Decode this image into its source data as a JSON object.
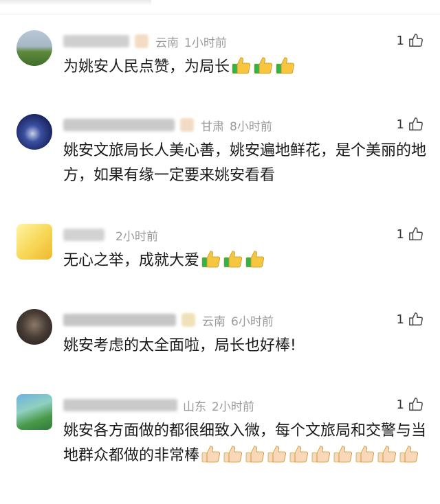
{
  "comments": [
    {
      "location": "云南",
      "time": "1小时前",
      "likes": "1",
      "text": "为姚安人民点赞，为局长",
      "emoji": {
        "name": "thumbs-up-emoji",
        "count": 3,
        "skin": "#f7c640",
        "cuff": "#2fb34a"
      }
    },
    {
      "location": "甘肃",
      "time": "8小时前",
      "likes": "1",
      "text": "姚安文旅局长人美心善，姚安遍地鲜花，是个美丽的地方，如果有缘一定要来姚安看看",
      "emoji": null
    },
    {
      "location": "",
      "time": "2小时前",
      "likes": "1",
      "text": "无心之举，成就大爱",
      "emoji": {
        "name": "thumbs-up-emoji",
        "count": 3,
        "skin": "#f7c640",
        "cuff": "#2fb34a"
      }
    },
    {
      "location": "云南",
      "time": "6小时前",
      "likes": "1",
      "text": "姚安考虑的太全面啦，局长也好棒!",
      "emoji": null
    },
    {
      "location": "山东",
      "time": "2小时前",
      "likes": "1",
      "text": "姚安各方面做的都很细致入微，每个文旅局和交警与当地群众都做的非常棒",
      "emoji": {
        "name": "thumbs-up-emoji",
        "count": 10,
        "skin": "#f8d8b8",
        "cuff": "#f8d8b8"
      }
    }
  ],
  "like_icon": "thumbs-up-outline-icon",
  "colors": {
    "meta": "#9a9a9a",
    "text": "#1a1a1a",
    "divider": "#ececec"
  }
}
